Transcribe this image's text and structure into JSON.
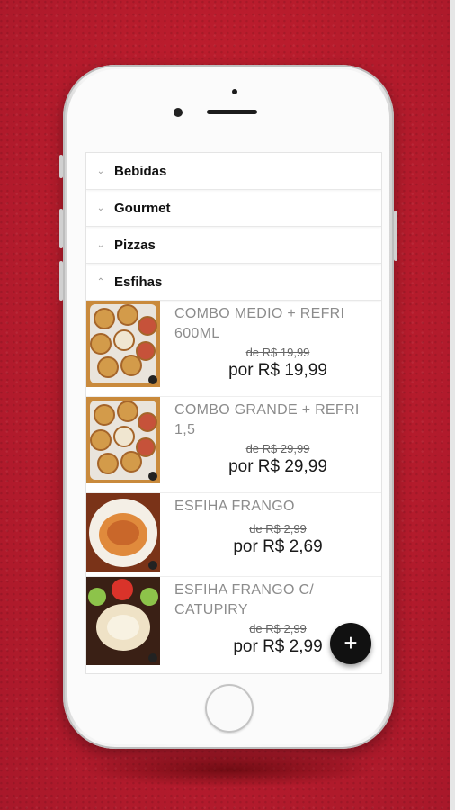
{
  "menu": {
    "categories": [
      {
        "label": "Bebidas",
        "icon": "chevron-down-icon",
        "expanded": false
      },
      {
        "label": "Gourmet",
        "icon": "chevron-down-icon",
        "expanded": false
      },
      {
        "label": "Pizzas",
        "icon": "chevron-down-icon",
        "expanded": false
      },
      {
        "label": "Esfihas",
        "icon": "chevron-up-icon",
        "expanded": true
      }
    ],
    "products": [
      {
        "name": "COMBO MEDIO + REFRI 600ML",
        "old_price": "de R$ 19,99",
        "new_price": "por R$ 19,99",
        "image": "combo-esfihas-photo"
      },
      {
        "name": "COMBO GRANDE + REFRI 1,5",
        "old_price": "de R$ 29,99",
        "new_price": "por R$ 29,99",
        "image": "combo-esfihas-photo"
      },
      {
        "name": "ESFIHA FRANGO",
        "old_price": "de R$ 2,99",
        "new_price": "por R$ 2,69",
        "image": "esfiha-frango-photo"
      },
      {
        "name": "ESFIHA FRANGO C/ CATUPIRY",
        "old_price": "de R$ 2,99",
        "new_price": "por R$ 2,99",
        "image": "esfiha-catupiry-photo"
      }
    ]
  },
  "fab": {
    "label": "+",
    "icon": "add-icon"
  },
  "colors": {
    "background": "#b81e2c",
    "fab": "#111111",
    "accent_text": "#8c8c8c"
  }
}
